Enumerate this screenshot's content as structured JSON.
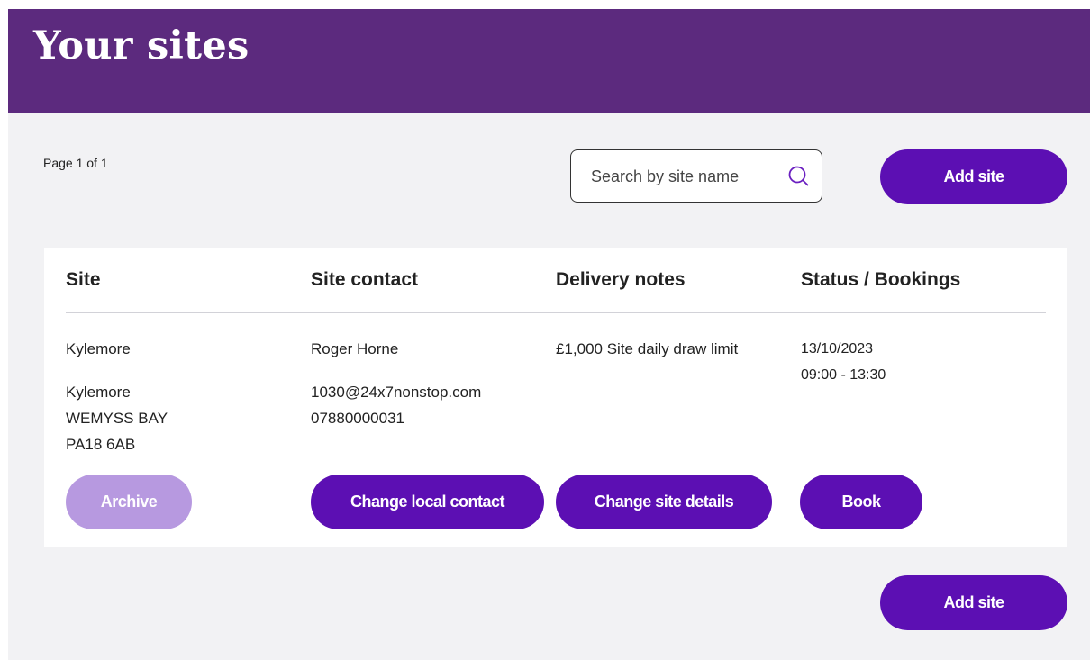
{
  "header": {
    "title": "Your sites"
  },
  "pagination": {
    "text": "Page 1 of 1"
  },
  "search": {
    "placeholder": "Search by site name",
    "value": "",
    "icon": "search-icon"
  },
  "actions": {
    "add_site_top": "Add site",
    "add_site_bottom": "Add site"
  },
  "table": {
    "columns": [
      "Site",
      "Site contact",
      "Delivery notes",
      "Status / Bookings"
    ],
    "rows": [
      {
        "site_name": "Kylemore",
        "address": [
          "Kylemore",
          "WEMYSS BAY",
          "PA18 6AB"
        ],
        "contact_name": "Roger Horne",
        "contact_email": "1030@24x7nonstop.com",
        "contact_phone": "07880000031",
        "delivery_notes": "£1,000 Site daily draw limit",
        "booking_date": "13/10/2023",
        "booking_time": "09:00 - 13:30",
        "buttons": {
          "archive": "Archive",
          "change_contact": "Change local contact",
          "change_details": "Change site details",
          "book": "Book"
        }
      }
    ]
  },
  "colors": {
    "header_bg": "#5c2a7e",
    "primary_button": "#5c0fb3",
    "disabled_button": "#b799e0",
    "page_bg": "#f2f2f4",
    "search_icon": "#6a1fc0"
  }
}
